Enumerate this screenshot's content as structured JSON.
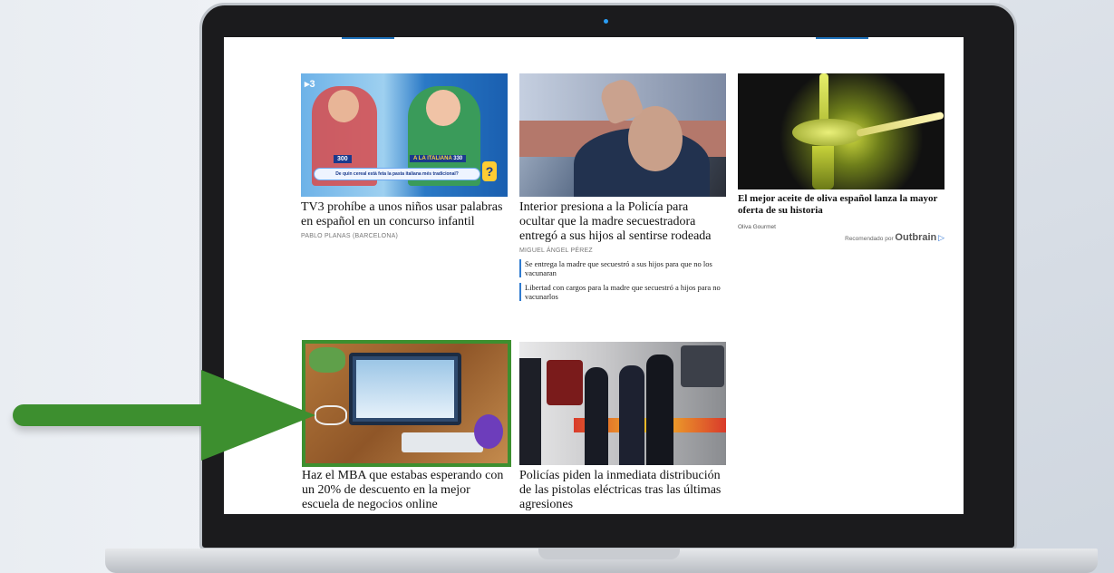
{
  "articles": [
    {
      "headline": "TV3 prohíbe a unos niños usar palabras en español en un concurso infantil",
      "byline": "PABLO PLANAS (BARCELONA)",
      "thumb_caption": "De quin cereal està feta la pasta italiana més tradicional?",
      "thumb_score_left": "300",
      "thumb_score_right": "330",
      "thumb_team": "A LA ITALIANA",
      "thumb_channel": "3"
    },
    {
      "headline": "Interior presiona a la Policía para ocultar que la madre secuestradora entregó a sus hijos al sentirse rodeada",
      "byline": "MIGUEL ÁNGEL PÉREZ",
      "related": [
        "Se entrega la madre que secuestró a sus hijos para que no los vacunaran",
        "Libertad con cargos para la madre que secuestró a hijos para no vacunarlos"
      ]
    },
    {
      "headline": "El mejor aceite de oliva español lanza la mayor oferta de su historia",
      "sponsor": "Oliva Gourmet",
      "recommended_prefix": "Recomendado por",
      "recommended_brand": "Outbrain"
    },
    {
      "headline": "Haz el MBA que estabas esperando con un 20% de descuento en la mejor escuela de negocios online"
    },
    {
      "headline": "Policías piden la inmediata distribución de las pistolas eléctricas tras las últimas agresiones"
    }
  ],
  "colors": {
    "highlight": "#3d8f2f",
    "accent": "#2f7bd0"
  }
}
